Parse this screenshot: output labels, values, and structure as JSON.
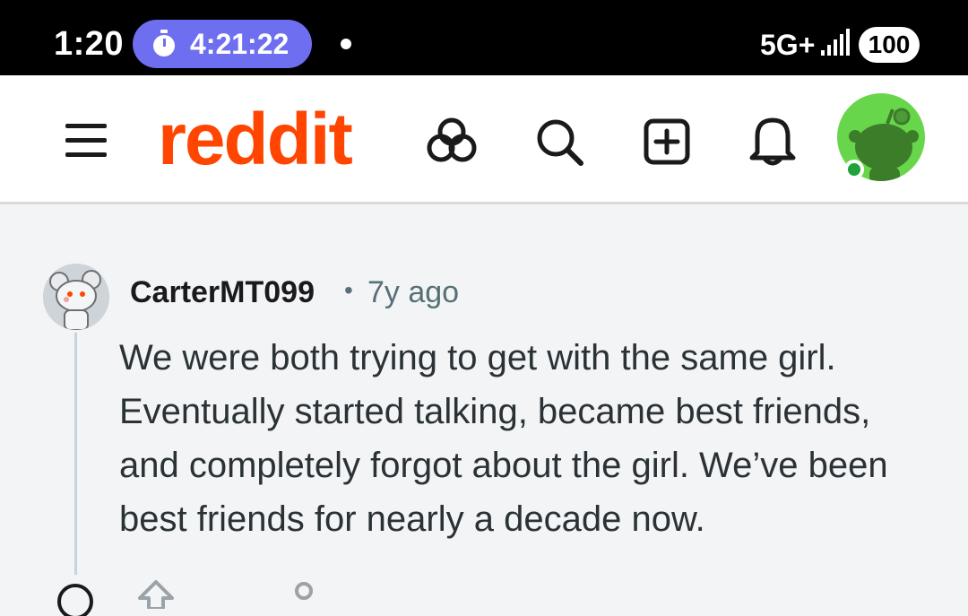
{
  "status_bar": {
    "time": "1:20",
    "timer": "4:21:22",
    "network": "5G+",
    "battery": "100"
  },
  "header": {
    "logo": "reddit",
    "icons": [
      "menu-icon",
      "communities-icon",
      "search-icon",
      "create-post-icon",
      "notifications-icon",
      "user-avatar"
    ],
    "accent_color": "#ff4500"
  },
  "comment": {
    "username": "CarterMT099",
    "separator": "•",
    "time_ago": "7y ago",
    "body": "We were both trying to get with the same girl. Eventually started talking, became best friends, and completely forgot about the girl. We’ve been best friends for nearly a decade now.",
    "actions": [
      "collapse-icon",
      "upvote-icon",
      "share-icon"
    ]
  }
}
